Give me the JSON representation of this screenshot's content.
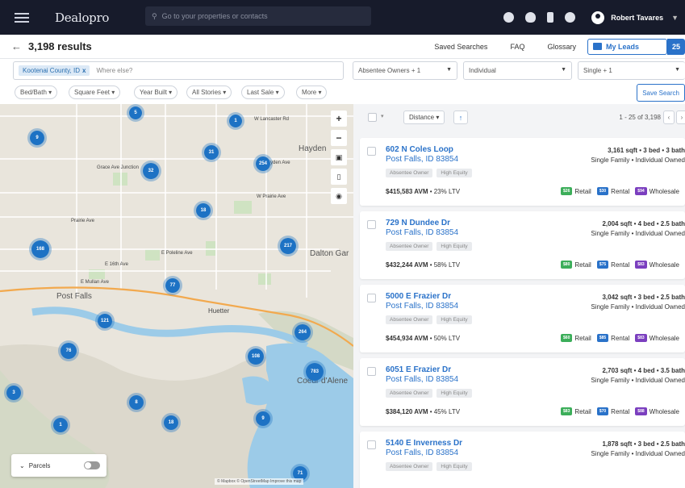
{
  "topbar": {
    "logo": "Dealopro",
    "search_placeholder": "Go to your properties or contacts",
    "user_name": "Robert Tavares"
  },
  "header": {
    "results": "3,198 results",
    "links": [
      "Saved Searches",
      "FAQ",
      "Glossary"
    ],
    "my_leads": "My Leads",
    "my_leads_count": "25"
  },
  "filters": {
    "chip": "Kootenai County, ID",
    "where_placeholder": "Where else?",
    "owner_type": "Absentee Owners + 1",
    "ownership": "Individual",
    "property_type": "Single + 1",
    "pills": [
      "Bed/Bath",
      "Square Feet",
      "Year Built",
      "All Stories",
      "Last Sale",
      "More"
    ],
    "save_search": "Save Search"
  },
  "map": {
    "labels": {
      "post_falls": "Post Falls",
      "huetter": "Huetter",
      "hayden": "Hayden",
      "dalton": "Dalton Gar",
      "cda": "Coeur d'Alene",
      "roads": [
        "W Lancaster Rd",
        "W Hayden Ave",
        "W Prairie Ave",
        "E Poleline Ave",
        "E 16th Ave",
        "E Mullan Ave",
        "Prairie Ave",
        "Grace Ave Junction"
      ]
    },
    "clusters": [
      "5",
      "9",
      "1",
      "31",
      "32",
      "254",
      "18",
      "168",
      "217",
      "77",
      "121",
      "264",
      "76",
      "108",
      "783",
      "3",
      "8",
      "1",
      "18",
      "9",
      "71"
    ],
    "parcels_label": "Parcels",
    "attribution": "© Mapbox © OpenStreetMap Improve this map"
  },
  "list": {
    "sort": "Distance",
    "pager": "1 - 25 of 3,198",
    "badge_labels": [
      "Retail",
      "Rental",
      "Wholesale"
    ],
    "cards": [
      {
        "street": "602 N Coles Loop",
        "city": "Post Falls, ID 83854",
        "tags": [
          "Absentee Owner",
          "High Equity"
        ],
        "stats1": "3,161 sqft • 3 bed • 3 bath",
        "stats2": "Single Family • Individual Owned",
        "avm": "$415,583 AVM",
        "ltv": " • 23% LTV",
        "badges": [
          "$26",
          "$30",
          "$94"
        ]
      },
      {
        "street": "729 N Dundee Dr",
        "city": "Post Falls, ID 83854",
        "tags": [
          "Absentee Owner",
          "High Equity"
        ],
        "stats1": "2,004 sqft • 4 bed • 2.5 bath",
        "stats2": "Single Family • Individual Owned",
        "avm": "$432,244 AVM",
        "ltv": " • 58% LTV",
        "badges": [
          "$80",
          "$75",
          "$83"
        ]
      },
      {
        "street": "5000 E Frazier Dr",
        "city": "Post Falls, ID 83854",
        "tags": [
          "Absentee Owner",
          "High Equity"
        ],
        "stats1": "3,042 sqft • 3 bed • 2.5 bath",
        "stats2": "Single Family • Individual Owned",
        "avm": "$454,934 AVM",
        "ltv": " • 50% LTV",
        "badges": [
          "$60",
          "$85",
          "$83"
        ]
      },
      {
        "street": "6051 E Frazier Dr",
        "city": "Post Falls, ID 83854",
        "tags": [
          "Absentee Owner",
          "High Equity"
        ],
        "stats1": "2,703 sqft • 4 bed • 3.5 bath",
        "stats2": "Single Family • Individual Owned",
        "avm": "$384,120 AVM",
        "ltv": " • 45% LTV",
        "badges": [
          "$83",
          "$70",
          "$88"
        ]
      },
      {
        "street": "5140 E Inverness Dr",
        "city": "Post Falls, ID 83854",
        "tags": [
          "Absentee Owner",
          "High Equity"
        ],
        "stats1": "1,878 sqft • 3 bed • 2.5 bath",
        "stats2": "Single Family • Individual Owned",
        "avm": "",
        "ltv": "",
        "badges": []
      }
    ]
  },
  "colors": {
    "accent": "#2a72c9",
    "topbar": "#171b2b",
    "cluster": "#1d72c4",
    "retail": "#3cae5a",
    "rental": "#2a72c9",
    "wholesale": "#7b3fbf"
  }
}
